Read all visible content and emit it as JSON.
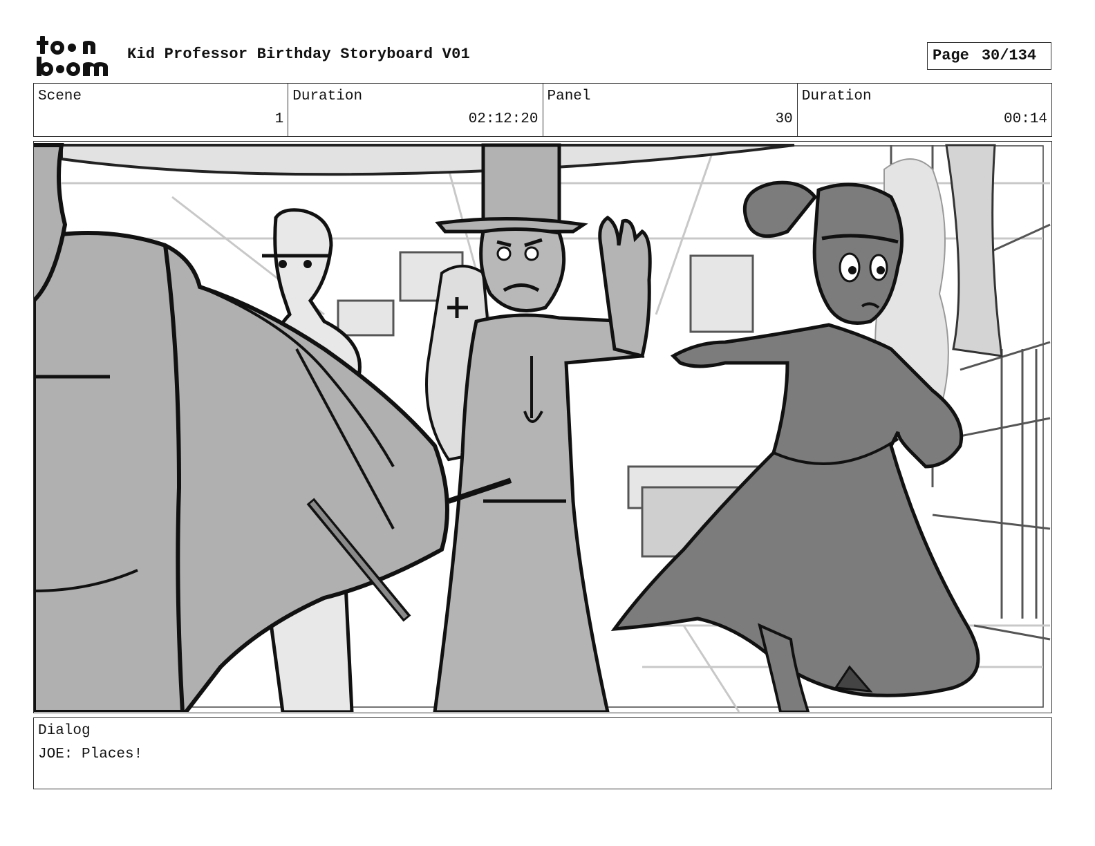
{
  "header": {
    "logo_icon": "toonboom-logo",
    "logo_text_top": "toon",
    "logo_text_bottom": "boom",
    "title": "Kid Professor Birthday Storyboard V01",
    "page_label": "Page",
    "page_value": "30/134"
  },
  "info": {
    "scene_label": "Scene",
    "scene_value": "1",
    "duration_label": "Duration",
    "duration_value": "02:12:20",
    "panel_label": "Panel",
    "panel_value": "30",
    "panel_duration_label": "Duration",
    "panel_duration_value": "00:14"
  },
  "panel_image": {
    "icon": "storyboard-sketch-image",
    "colors": {
      "background": "#ffffff",
      "light_gray": "#e2e2e2",
      "mid_gray": "#b4b4b4",
      "dark_gray": "#7e7e7e",
      "line": "#111111"
    }
  },
  "dialog": {
    "label": "Dialog",
    "text": "JOE: Places!"
  }
}
